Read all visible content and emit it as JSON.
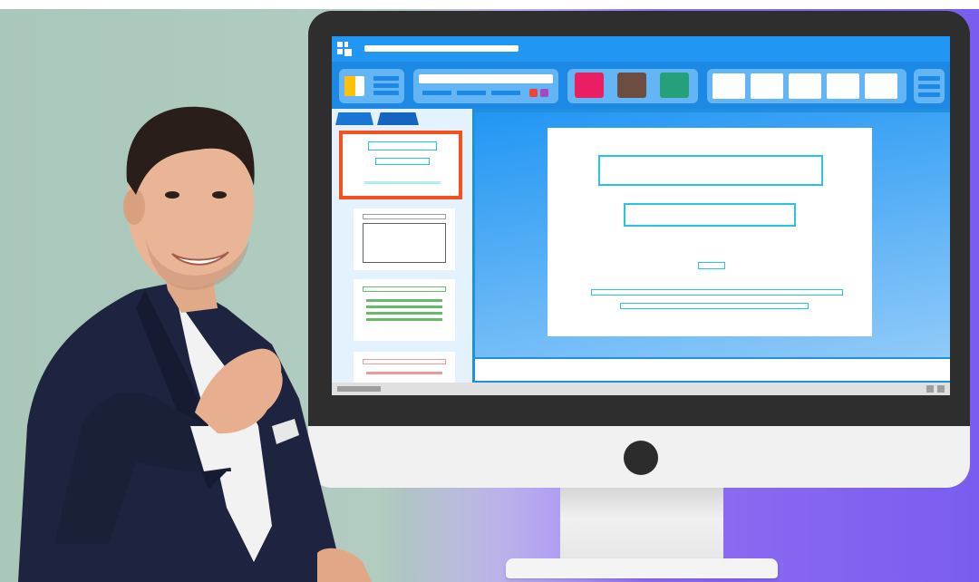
{
  "colors": {
    "background_left": "#a9c7ba",
    "background_right": "#7a5cf0",
    "monitor_bezel": "#2e2e2e",
    "screen_blue": "#1f8fe0",
    "accent_orange": "#f4511e",
    "swatch_pink": "#e91e63",
    "swatch_brown": "#6d4c41",
    "swatch_green": "#26a07a",
    "placeholder_cyan": "#26c6da"
  },
  "icons": {
    "app": "grid-app-icon",
    "camera": "webcam-icon",
    "menu": "hamburger-menu-icon"
  },
  "slides_panel": {
    "selected_index": 0
  }
}
